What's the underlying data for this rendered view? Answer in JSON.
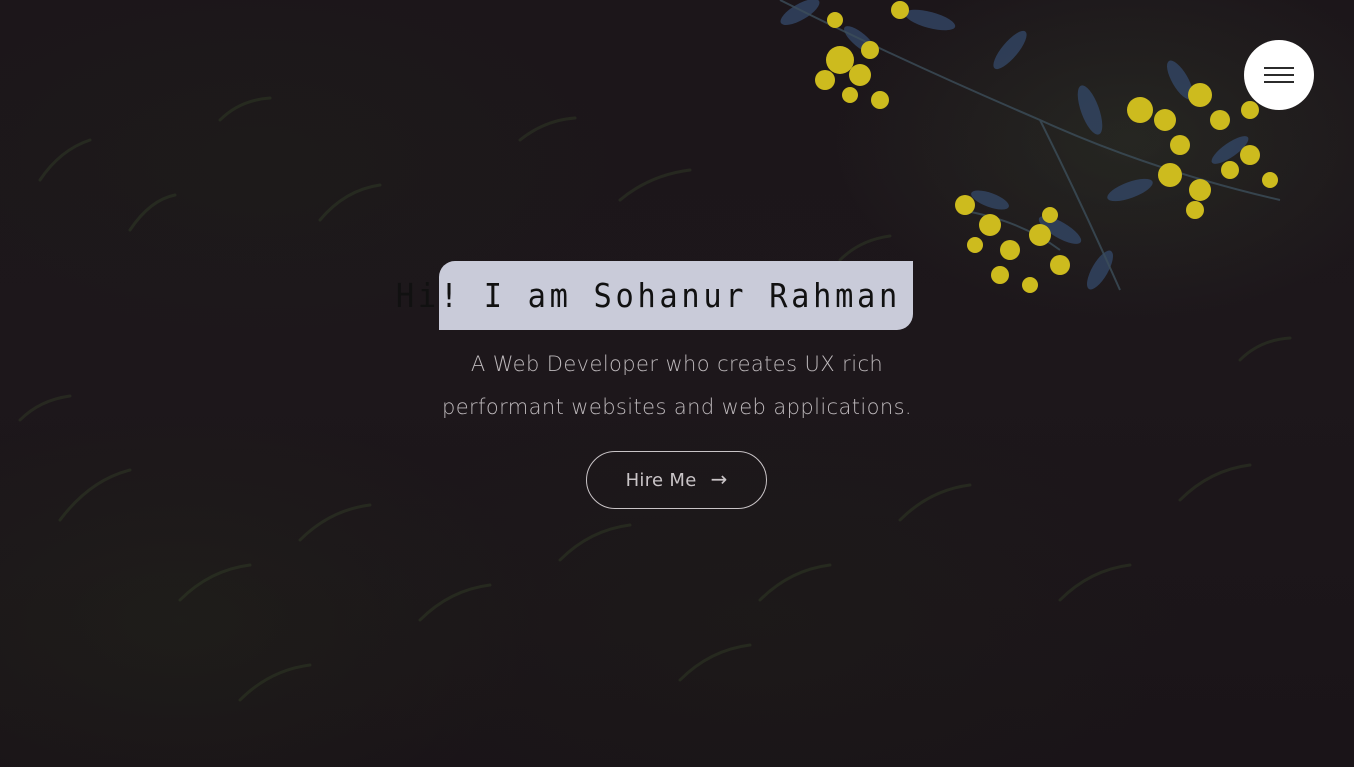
{
  "hero": {
    "title": "Hi! I am Sohanur Rahman",
    "subtitle_line1": "A Web Developer who creates UX rich",
    "subtitle_line2": "performant websites and web applications.",
    "cta_label": "Hire Me",
    "cta_icon": "arrow-right-icon",
    "background_image": "dark foliage with yellow wattle flowers"
  },
  "nav": {
    "menu_icon": "hamburger-icon"
  },
  "colors": {
    "background": "#1c161a",
    "title_box": "#c9cbd9",
    "title_text": "#111111",
    "subtitle_text": "#bdb8bb",
    "button_border": "#c9c4c7",
    "menu_button": "#ffffff",
    "flowers": "#d4c21c",
    "leaves": "#3b4f6e"
  }
}
